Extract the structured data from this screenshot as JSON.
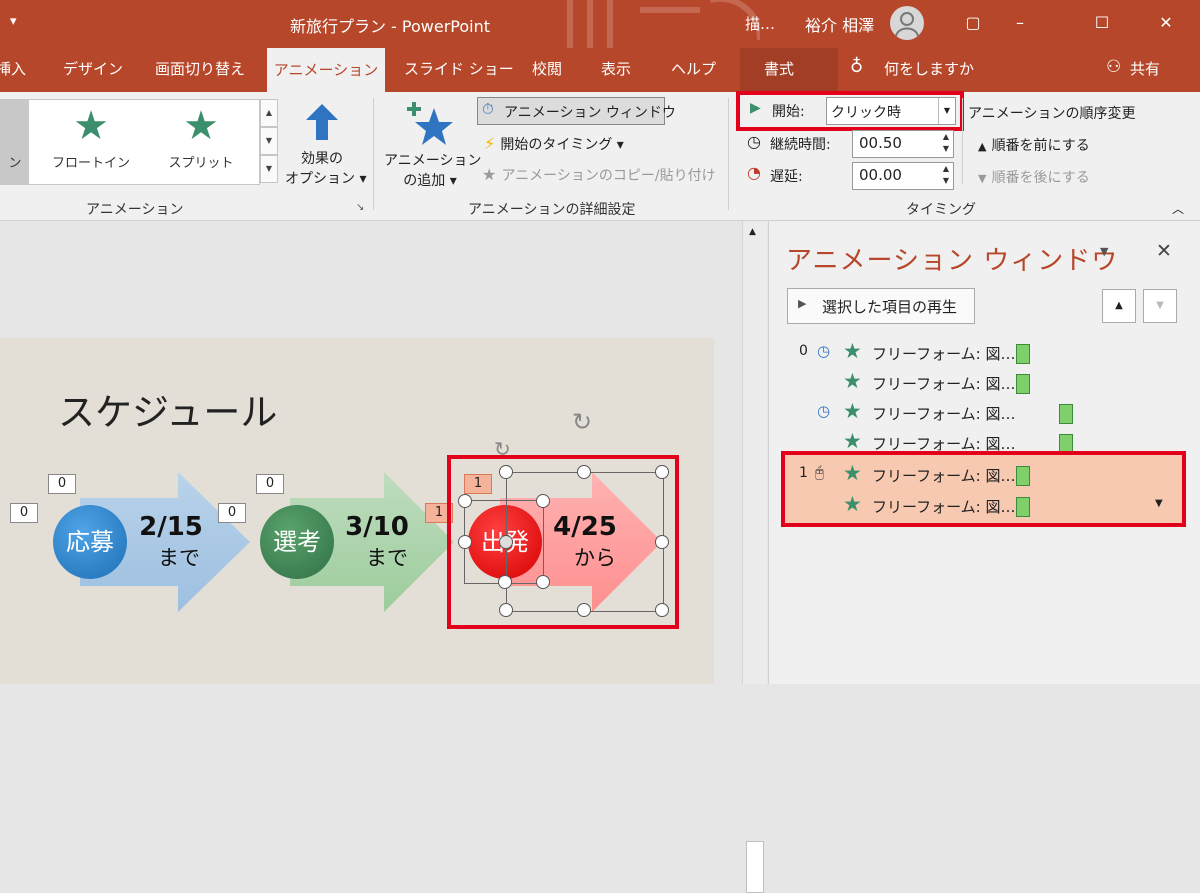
{
  "titlebar": {
    "qat": "▾",
    "app_title": "新旅行プラン - PowerPoint",
    "search_snip": "描…",
    "user_name": "裕介 相澤",
    "win_restore": "▢",
    "win_maximize": "☐",
    "win_close": "✕"
  },
  "tabs": [
    {
      "label": "挿入"
    },
    {
      "label": "デザイン"
    },
    {
      "label": "画面切り替え"
    },
    {
      "label": "アニメーション"
    },
    {
      "label": "スライド ショー"
    },
    {
      "label": "校閲"
    },
    {
      "label": "表示"
    },
    {
      "label": "ヘルプ"
    },
    {
      "label": "書式"
    },
    {
      "label": "何をしますか"
    },
    {
      "label": "共有"
    }
  ],
  "ribbon": {
    "gallery": [
      {
        "label": "ン"
      },
      {
        "label": "フロートイン"
      },
      {
        "label": "スプリット"
      }
    ],
    "effect_options": [
      "効果の",
      "オプション ▾"
    ],
    "group_animation": "アニメーション",
    "add_animation": [
      "アニメーション",
      "の追加 ▾"
    ],
    "anim_window": "アニメーション ウィンドウ",
    "start_timing": "開始のタイミング ▾",
    "copy_paste": "アニメーションのコピー/貼り付け",
    "group_advanced": "アニメーションの詳細設定",
    "start_label": "開始:",
    "start_value": "クリック時",
    "duration_label": "継続時間:",
    "duration_value": "00.50",
    "delay_label": "遅延:",
    "delay_value": "00.00",
    "reorder_title": "アニメーションの順序変更",
    "move_earlier": "順番を前にする",
    "move_later": "順番を後にする",
    "group_timing": "タイミング"
  },
  "slide": {
    "title": "スケジュール",
    "steps": [
      {
        "circle": "応募",
        "date": "2/15",
        "sub": "まで",
        "tag": "0"
      },
      {
        "circle": "選考",
        "date": "3/10",
        "sub": "まで",
        "tag": "0"
      },
      {
        "circle": "出発",
        "date": "4/25",
        "sub": "から",
        "tag": "1"
      }
    ],
    "tags_extra": [
      "0",
      "0",
      "1"
    ]
  },
  "pane": {
    "title": "アニメーション ウィンドウ",
    "play_button": "選択した項目の再生",
    "items": [
      {
        "idx": "0",
        "label": "フリーフォーム: 図…"
      },
      {
        "idx": "",
        "label": "フリーフォーム: 図…"
      },
      {
        "idx": "",
        "label": "フリーフォーム: 図…"
      },
      {
        "idx": "",
        "label": "フリーフォーム: 図…"
      },
      {
        "idx": "1",
        "label": "フリーフォーム: 図…"
      },
      {
        "idx": "",
        "label": "フリーフォーム: 図…"
      }
    ]
  },
  "colors": {
    "accent": "#b7472a",
    "highlight_red": "#e3001b",
    "selected_row": "#f7c9b0",
    "star_green": "#3b8f6c"
  }
}
